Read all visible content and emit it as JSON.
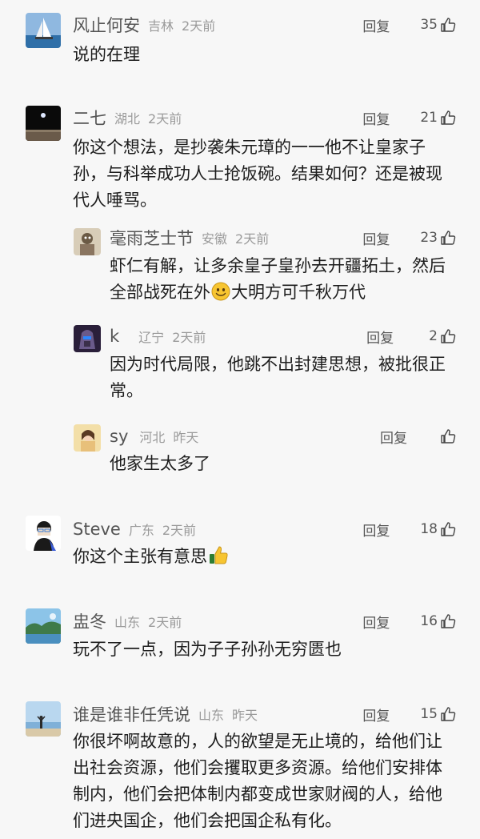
{
  "comments": [
    {
      "name": "风止何安",
      "location": "吉林",
      "time": "2天前",
      "reply": "回复",
      "likes": "35",
      "text": "说的在理"
    },
    {
      "name": "二七",
      "location": "湖北",
      "time": "2天前",
      "reply": "回复",
      "likes": "21",
      "text": "你这个想法，是抄袭朱元璋的一一他不让皇家子孙，与科举成功人士抢饭碗。结果如何？还是被现代人唾骂。"
    },
    {
      "name": "毫雨芝士节",
      "location": "安徽",
      "time": "2天前",
      "reply": "回复",
      "likes": "23",
      "text_a": "虾仁有解，让多余皇子皇孙去开疆拓土，然后全部战死在外",
      "text_b": "大明方可千秋万代"
    },
    {
      "name": "k",
      "location": "辽宁",
      "time": "2天前",
      "reply": "回复",
      "likes": "2",
      "text": "因为时代局限，他跳不出封建思想，被批很正常。"
    },
    {
      "name": "sy",
      "location": "河北",
      "time": "昨天",
      "reply": "回复",
      "likes": "",
      "text": "他家生太多了"
    },
    {
      "name": "Steve",
      "location": "广东",
      "time": "2天前",
      "reply": "回复",
      "likes": "18",
      "text": "你这个主张有意思"
    },
    {
      "name": "盅冬",
      "location": "山东",
      "time": "2天前",
      "reply": "回复",
      "likes": "16",
      "text": "玩不了一点，因为子子孙孙无穷匮也"
    },
    {
      "name": "谁是谁非任凭说",
      "location": "山东",
      "time": "昨天",
      "reply": "回复",
      "likes": "15",
      "text": "你很坏啊故意的，人的欲望是无止境的，给他们让出社会资源，他们会攫取更多资源。给他们安排体制内，他们会把体制内都变成世家财阀的人，给他们进央国企，他们会把国企私有化。"
    }
  ],
  "icons": {
    "like": "thumbs-up-icon",
    "smile": "smile-emoji-icon",
    "thumbs_emoji": "thumbs-up-emoji-icon"
  },
  "colors": {
    "background": "#f7f7f7",
    "name": "#555555",
    "meta": "#9a9a9a",
    "text": "#1d1d1d"
  }
}
